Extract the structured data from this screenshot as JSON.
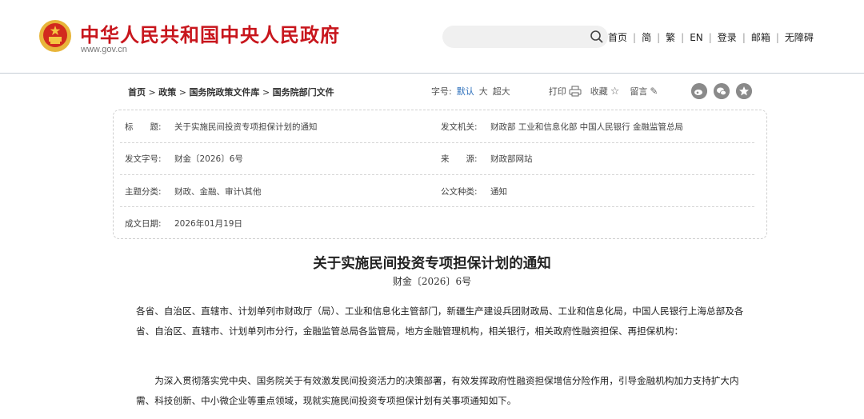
{
  "header": {
    "site_title": "中华人民共和国中央人民政府",
    "site_url": "www.gov.cn",
    "nav": [
      "首页",
      "简",
      "繁",
      "EN",
      "登录",
      "邮箱",
      "无障碍"
    ]
  },
  "breadcrumb": [
    "首页",
    "政策",
    "国务院政策文件库",
    "国务院部门文件"
  ],
  "tools": {
    "font_label": "字号:",
    "font_default": "默认",
    "font_large": "大",
    "font_xlarge": "超大",
    "print": "打印",
    "favorite": "收藏",
    "comment": "留言"
  },
  "info": {
    "title_label": "标　　题:",
    "title_value": "关于实施民间投资专项担保计划的通知",
    "issuer_label": "发文机关:",
    "issuer_value": "财政部 工业和信息化部 中国人民银行 金融监管总局",
    "docno_label": "发文字号:",
    "docno_value": "财金〔2026〕6号",
    "source_label": "来　　源:",
    "source_value": "财政部网站",
    "category_label": "主题分类:",
    "category_value": "财政、金融、审计\\其他",
    "doctype_label": "公文种类:",
    "doctype_value": "通知",
    "date_label": "成文日期:",
    "date_value": "2026年01月19日"
  },
  "article": {
    "title": "关于实施民间投资专项担保计划的通知",
    "number": "财金〔2026〕6号",
    "para1": "各省、自治区、直辖市、计划单列市财政厅（局）、工业和信息化主管部门，新疆生产建设兵团财政局、工业和信息化局，中国人民银行上海总部及各省、自治区、直辖市、计划单列市分行，金融监管总局各监管局，地方金融管理机构，相关银行，相关政府性融资担保、再担保机构：",
    "para2": "为深入贯彻落实党中央、国务院关于有效激发民间投资活力的决策部署，有效发挥政府性融资担保增信分险作用，引导金融机构加力支持扩大内需、科技创新、中小微企业等重点领域，现就实施民间投资专项担保计划有关事项通知如下。"
  }
}
